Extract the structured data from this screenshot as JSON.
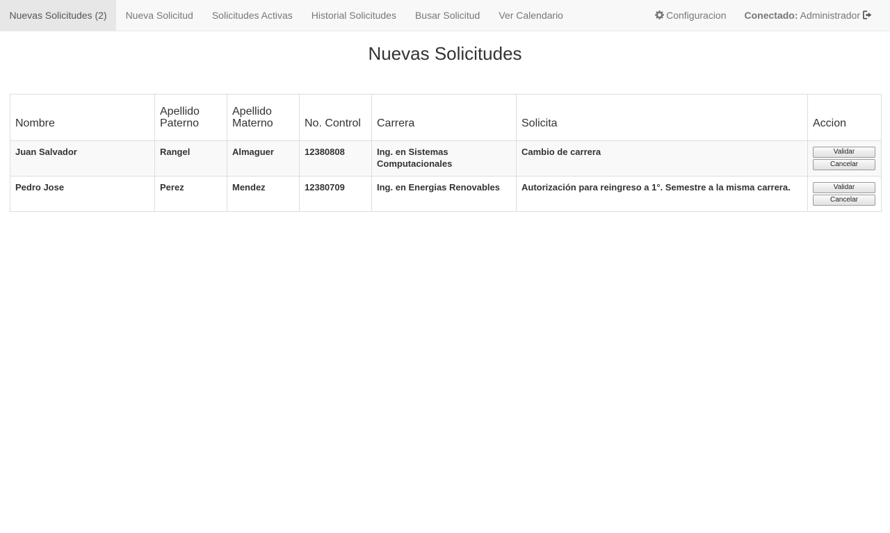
{
  "nav": {
    "items": [
      {
        "label": "Nuevas Solicitudes (2)"
      },
      {
        "label": "Nueva Solicitud"
      },
      {
        "label": "Solicitudes Activas"
      },
      {
        "label": "Historial Solicitudes"
      },
      {
        "label": "Busar Solicitud"
      },
      {
        "label": "Ver Calendario"
      }
    ],
    "config_label": "Configuracion",
    "connected_label": "Conectado:",
    "user": "Administrador",
    "config_icon": "gear-icon",
    "logout_icon": "sign-out-icon"
  },
  "page": {
    "title": "Nuevas Solicitudes"
  },
  "table": {
    "headers": {
      "nombre": "Nombre",
      "apellido_paterno_1": "Apellido",
      "apellido_paterno_2": "Paterno",
      "apellido_materno_1": "Apellido",
      "apellido_materno_2": "Materno",
      "no_control": "No. Control",
      "carrera": "Carrera",
      "solicita": "Solicita",
      "accion": "Accion"
    },
    "rows": [
      {
        "nombre": "Juan Salvador",
        "apellido_paterno": "Rangel",
        "apellido_materno": "Almaguer",
        "no_control": "12380808",
        "carrera": "Ing. en Sistemas Computacionales",
        "solicita": "Cambio de carrera",
        "validar": "Validar",
        "cancelar": "Cancelar"
      },
      {
        "nombre": "Pedro Jose",
        "apellido_paterno": "Perez",
        "apellido_materno": "Mendez",
        "no_control": "12380709",
        "carrera": "Ing. en Energias Renovables",
        "solicita": "Autorización para reingreso a 1°. Semestre a la misma carrera.",
        "validar": "Validar",
        "cancelar": "Cancelar"
      }
    ]
  },
  "colors": {
    "navbar_bg": "#f8f8f8",
    "nav_active_bg": "#e7e7e7",
    "nav_text": "#777777",
    "text": "#333333",
    "table_border": "#dddddd",
    "row_stripe": "#f9f9f9"
  }
}
